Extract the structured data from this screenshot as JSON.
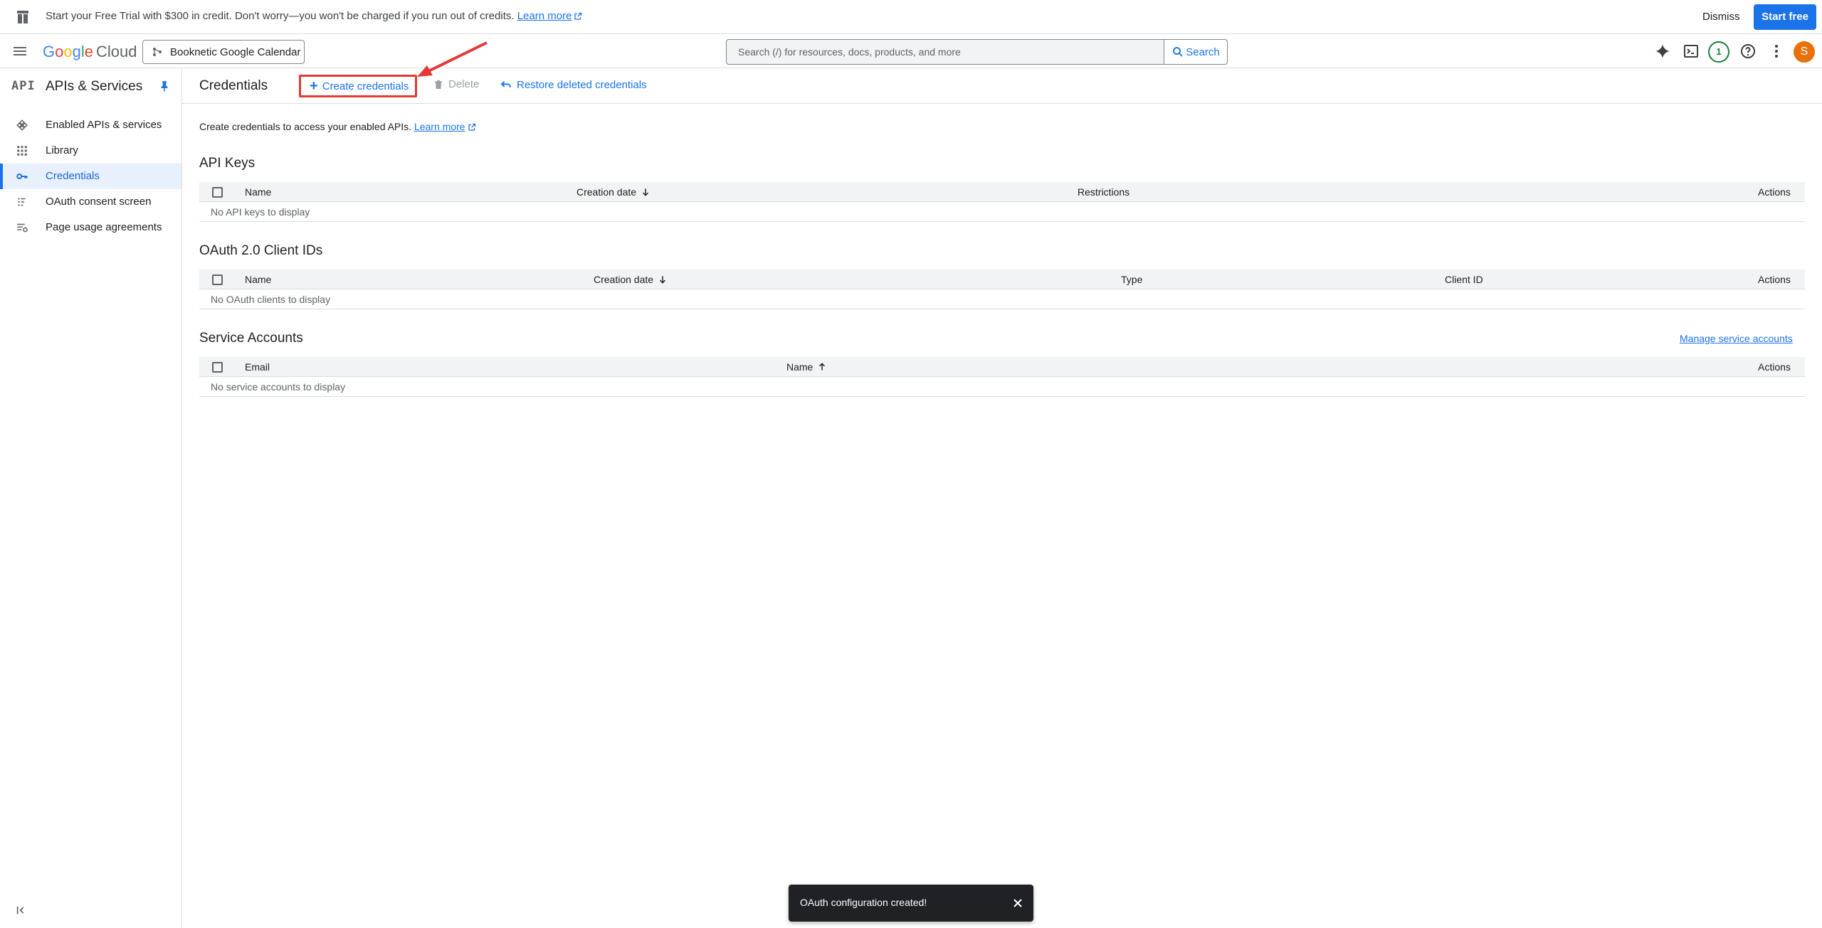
{
  "banner": {
    "message": "Start your Free Trial with $300 in credit. Don't worry—you won't be charged if you run out of credits.",
    "learn_more": "Learn more",
    "dismiss": "Dismiss",
    "start_free": "Start free"
  },
  "topbar": {
    "logo_google": [
      "G",
      "o",
      "o",
      "g",
      "l",
      "e"
    ],
    "logo_cloud": "Cloud",
    "project": "Booknetic Google Calendar",
    "search_placeholder": "Search (/) for resources, docs, products, and more",
    "search_button": "Search",
    "notification_count": "1",
    "avatar_initial": "S"
  },
  "sidebar": {
    "api_badge": "API",
    "title": "APIs & Services",
    "items": [
      {
        "label": "Enabled APIs & services",
        "icon": "enabled-apis-icon"
      },
      {
        "label": "Library",
        "icon": "library-icon"
      },
      {
        "label": "Credentials",
        "icon": "key-icon",
        "active": true
      },
      {
        "label": "OAuth consent screen",
        "icon": "oauth-consent-icon"
      },
      {
        "label": "Page usage agreements",
        "icon": "page-usage-icon"
      }
    ]
  },
  "header": {
    "title": "Credentials",
    "create": "Create credentials",
    "delete": "Delete",
    "restore": "Restore deleted credentials"
  },
  "content": {
    "intro": "Create credentials to access your enabled APIs.",
    "intro_link": "Learn more",
    "api_keys": {
      "title": "API Keys",
      "columns": [
        "Name",
        "Creation date",
        "Restrictions",
        "Actions"
      ],
      "empty": "No API keys to display"
    },
    "oauth": {
      "title": "OAuth 2.0 Client IDs",
      "columns": [
        "Name",
        "Creation date",
        "Type",
        "Client ID",
        "Actions"
      ],
      "empty": "No OAuth clients to display"
    },
    "service_accounts": {
      "title": "Service Accounts",
      "manage_link": "Manage service accounts",
      "columns": [
        "Email",
        "Name",
        "Actions"
      ],
      "empty": "No service accounts to display"
    }
  },
  "snackbar": {
    "message": "OAuth configuration created!"
  },
  "colors": {
    "accent": "#1a73e8",
    "highlight_box": "#e53935"
  }
}
